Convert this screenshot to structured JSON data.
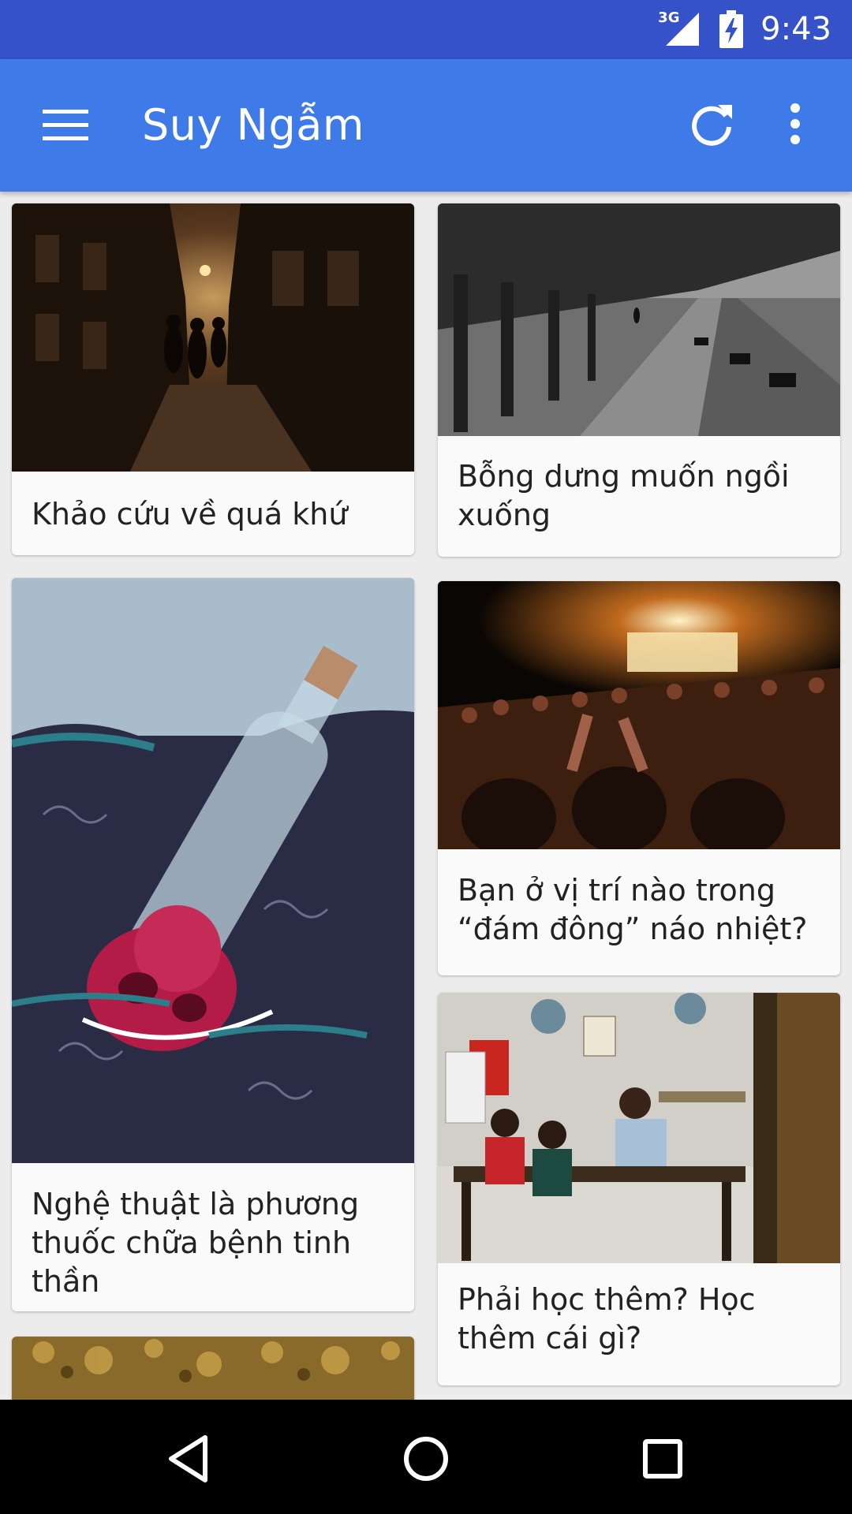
{
  "status_bar": {
    "network": "3G",
    "time": "9:43"
  },
  "app_bar": {
    "title": "Suy Ngẫm",
    "menu_icon": "hamburger-menu-icon",
    "refresh_icon": "refresh-icon",
    "overflow_icon": "more-vert-icon"
  },
  "articles": [
    {
      "title": "Khảo cứu về quá khứ",
      "image": "night-alley-photo"
    },
    {
      "title": "Bỗng dưng muốn ngồi xuống",
      "image": "rainy-park-benches-photo"
    },
    {
      "title": "Nghệ thuật là phương thuốc chữa bệnh tinh thần",
      "image": "heart-in-bottle-illustration"
    },
    {
      "title": "Bạn ở vị trí nào trong “đám đông” náo nhiệt?",
      "image": "concert-crowd-photo"
    },
    {
      "title": "Phải học thêm? Học thêm cái gì?",
      "image": "tutoring-classroom-photo"
    },
    {
      "title": "",
      "image": "golden-foliage-photo"
    }
  ],
  "colors": {
    "status_bar": "#3552c8",
    "app_bar": "#3f7ae9",
    "background": "#ececec",
    "card": "#fafafa",
    "nav_bar": "#000000"
  },
  "nav_bar": {
    "back_icon": "back-triangle-icon",
    "home_icon": "home-circle-icon",
    "recents_icon": "recents-square-icon"
  }
}
